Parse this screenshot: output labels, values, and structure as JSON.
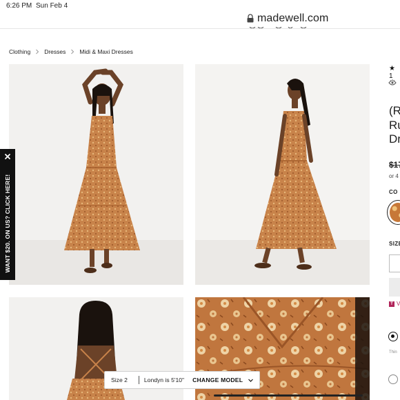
{
  "status_bar": {
    "time": "6:26 PM",
    "date": "Sun Feb 4"
  },
  "browser": {
    "domain": "madewell.com"
  },
  "breadcrumb": [
    "Clothing",
    "Dresses",
    "Midi & Maxi Dresses"
  ],
  "promo": {
    "text": "WANT $20. ON US? CLICK HERE!",
    "close_icon": "close-icon"
  },
  "model_bar": {
    "size": "Size 2",
    "model": "Londyn is 5'10\"",
    "change": "CHANGE MODEL"
  },
  "product": {
    "rating_star": "★",
    "rating_partial": "1",
    "title_lines": [
      "(R",
      "Ru",
      "Dr"
    ],
    "price_partial": "$17",
    "installments_partial": "or 4",
    "color_label": "CO",
    "size_label": "SIZE",
    "tv_link_partial": "V",
    "thin_text": "Thin"
  },
  "colors": {
    "dress": "#c8834a",
    "dress_dark": "#a65f2c",
    "skin": "#6b4228",
    "hair": "#1a120d",
    "brand_pink": "#b0245a"
  },
  "icons": [
    "lock-icon",
    "chevron-right-icon",
    "close-icon",
    "chevron-down-icon",
    "eye-icon",
    "star-icon"
  ]
}
